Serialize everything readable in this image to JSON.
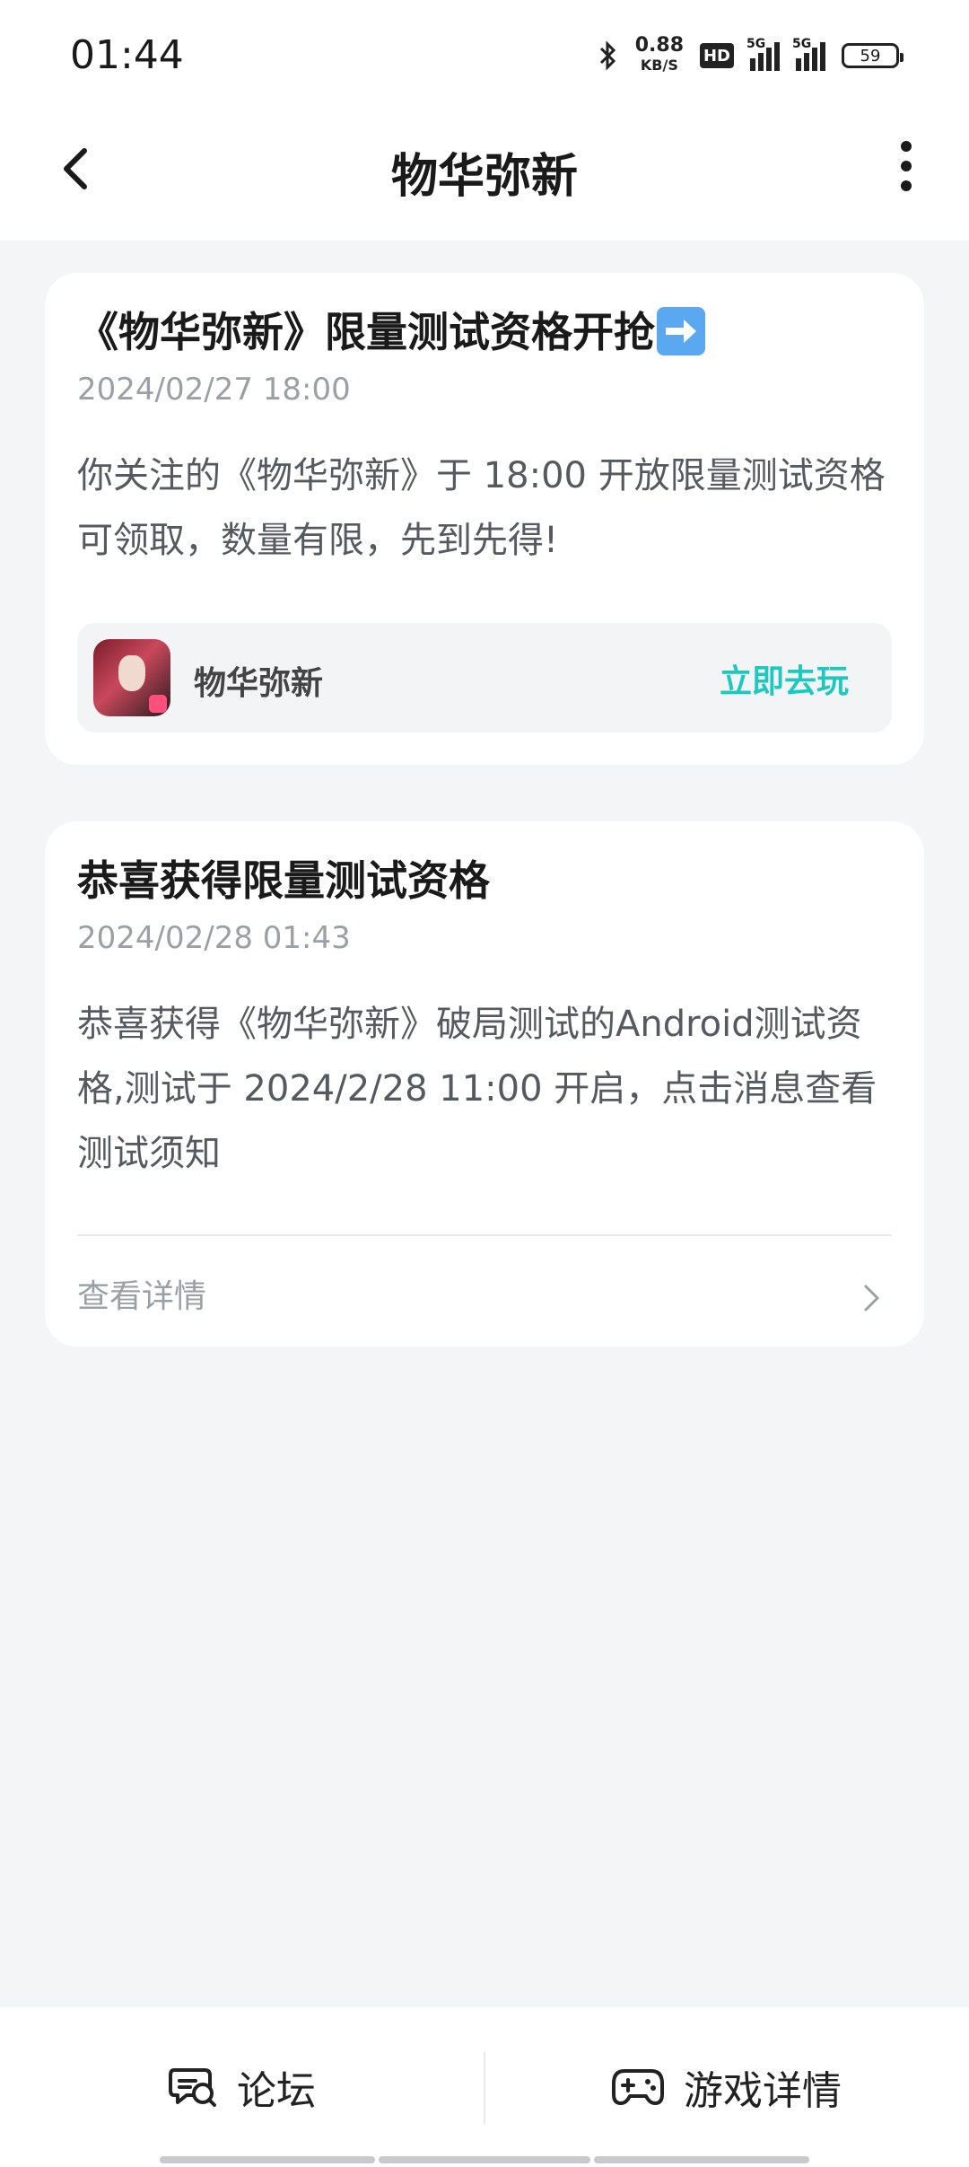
{
  "status_bar": {
    "time": "01:44",
    "net_speed": "0.88",
    "net_unit": "KB/S",
    "hd_label": "HD",
    "signal1_label": "5G",
    "signal2_label": "5G",
    "battery": "59"
  },
  "header": {
    "title": "物华弥新"
  },
  "cards": [
    {
      "title": "《物华弥新》限量测试资格开抢",
      "date": "2024/02/27 18:00",
      "body": "你关注的《物华弥新》于 18:00 开放限量测试资格可领取，数量有限，先到先得!",
      "game": {
        "name": "物华弥新",
        "action": "立即去玩"
      }
    },
    {
      "title": "恭喜获得限量测试资格",
      "date": "2024/02/28 01:43",
      "body": "恭喜获得《物华弥新》破局测试的Android测试资格,测试于 2024/2/28 11:00 开启，点击消息查看测试须知",
      "detail_label": "查看详情"
    }
  ],
  "bottom_bar": {
    "forum": "论坛",
    "game_details": "游戏详情"
  },
  "colors": {
    "accent": "#1cc8c0",
    "background": "#f4f5f7"
  }
}
